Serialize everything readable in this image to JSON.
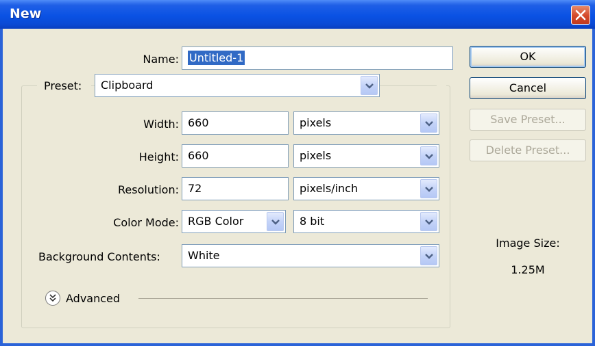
{
  "window": {
    "title": "New"
  },
  "form": {
    "name_label": "Name:",
    "name_value": "Untitled-1",
    "preset_label": "Preset:",
    "preset_value": "Clipboard",
    "width_label": "Width:",
    "width_value": "660",
    "width_unit": "pixels",
    "height_label": "Height:",
    "height_value": "660",
    "height_unit": "pixels",
    "resolution_label": "Resolution:",
    "resolution_value": "72",
    "resolution_unit": "pixels/inch",
    "color_mode_label": "Color Mode:",
    "color_mode_value": "RGB Color",
    "bit_depth_value": "8 bit",
    "background_label": "Background Contents:",
    "background_value": "White",
    "advanced_label": "Advanced"
  },
  "buttons": {
    "ok": "OK",
    "cancel": "Cancel",
    "save_preset": "Save Preset...",
    "delete_preset": "Delete Preset..."
  },
  "image_size": {
    "label": "Image Size:",
    "value": "1.25M"
  },
  "icons": {
    "close": "close-icon",
    "dropdown": "chevron-down-icon",
    "advanced": "double-chevron-down-icon"
  },
  "colors": {
    "title_bar": "#0a52e4",
    "dialog_bg": "#ece9d8",
    "selection": "#316ac5",
    "close_button": "#d4492a"
  }
}
